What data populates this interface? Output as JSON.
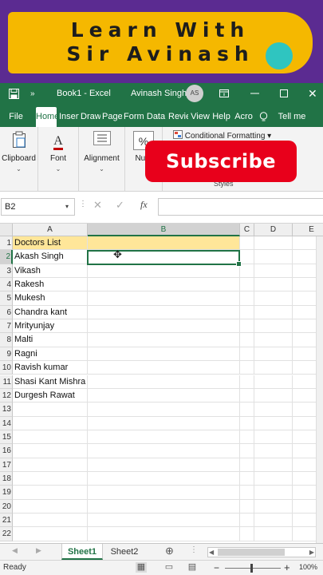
{
  "banner": {
    "line1": "Learn With",
    "line2": "Sir Avinash",
    "colors": {
      "background": "#5b2b91",
      "pill": "#f5b800",
      "dot": "#2fc5c0"
    }
  },
  "titlebar": {
    "autosave_more": "»",
    "doc_title": "Book1 - Excel",
    "user_name": "Avinash Singh",
    "user_initials": "AS",
    "accent": "#217346"
  },
  "tabs": [
    {
      "label": "File",
      "active": false
    },
    {
      "label": "Home",
      "active": true
    },
    {
      "label": "Insert",
      "active": false
    },
    {
      "label": "Draw",
      "active": false
    },
    {
      "label": "Page",
      "active": false
    },
    {
      "label": "Form",
      "active": false
    },
    {
      "label": "Data",
      "active": false
    },
    {
      "label": "Review",
      "active": false
    },
    {
      "label": "View",
      "active": false
    },
    {
      "label": "Help",
      "active": false
    },
    {
      "label": "Acro",
      "active": false
    },
    {
      "label": "Tell me",
      "active": false
    }
  ],
  "ribbon": {
    "clipboard": "Clipboard",
    "font": "Font",
    "alignment": "Alignment",
    "number": "Num",
    "conditional_formatting": "Conditional Formatting ▾",
    "styles": "Styles",
    "font_glyph": "A",
    "number_glyph": "%"
  },
  "overlay": {
    "subscribe": "Subscribe",
    "color": "#e8001b"
  },
  "formula_bar": {
    "name_box": "B2",
    "fx": "fx",
    "value": ""
  },
  "sheet": {
    "columns": [
      {
        "label": "A",
        "selected": false
      },
      {
        "label": "B",
        "selected": true
      },
      {
        "label": "C",
        "selected": false
      },
      {
        "label": "D",
        "selected": false
      },
      {
        "label": "E",
        "selected": false
      }
    ],
    "rows": [
      "1",
      "2",
      "3",
      "4",
      "5",
      "6",
      "7",
      "8",
      "9",
      "10",
      "11",
      "12",
      "13",
      "14",
      "15",
      "16",
      "17",
      "18",
      "19",
      "20",
      "21",
      "22"
    ],
    "selected_row": "2",
    "column_a": [
      "Doctors List",
      "Akash Singh",
      "Vikash",
      "Rakesh",
      "Mukesh",
      "Chandra kant",
      "Mrityunjay",
      "Malti",
      "Ragni",
      "Ravish kumar",
      "Shasi Kant Mishra",
      "Durgesh Rawat"
    ],
    "header_fill": "#ffe699"
  },
  "sheet_tabs": {
    "sheet1": "Sheet1",
    "sheet2": "Sheet2",
    "add": "⊕"
  },
  "status": {
    "text": "Ready",
    "zoom": "100%"
  }
}
